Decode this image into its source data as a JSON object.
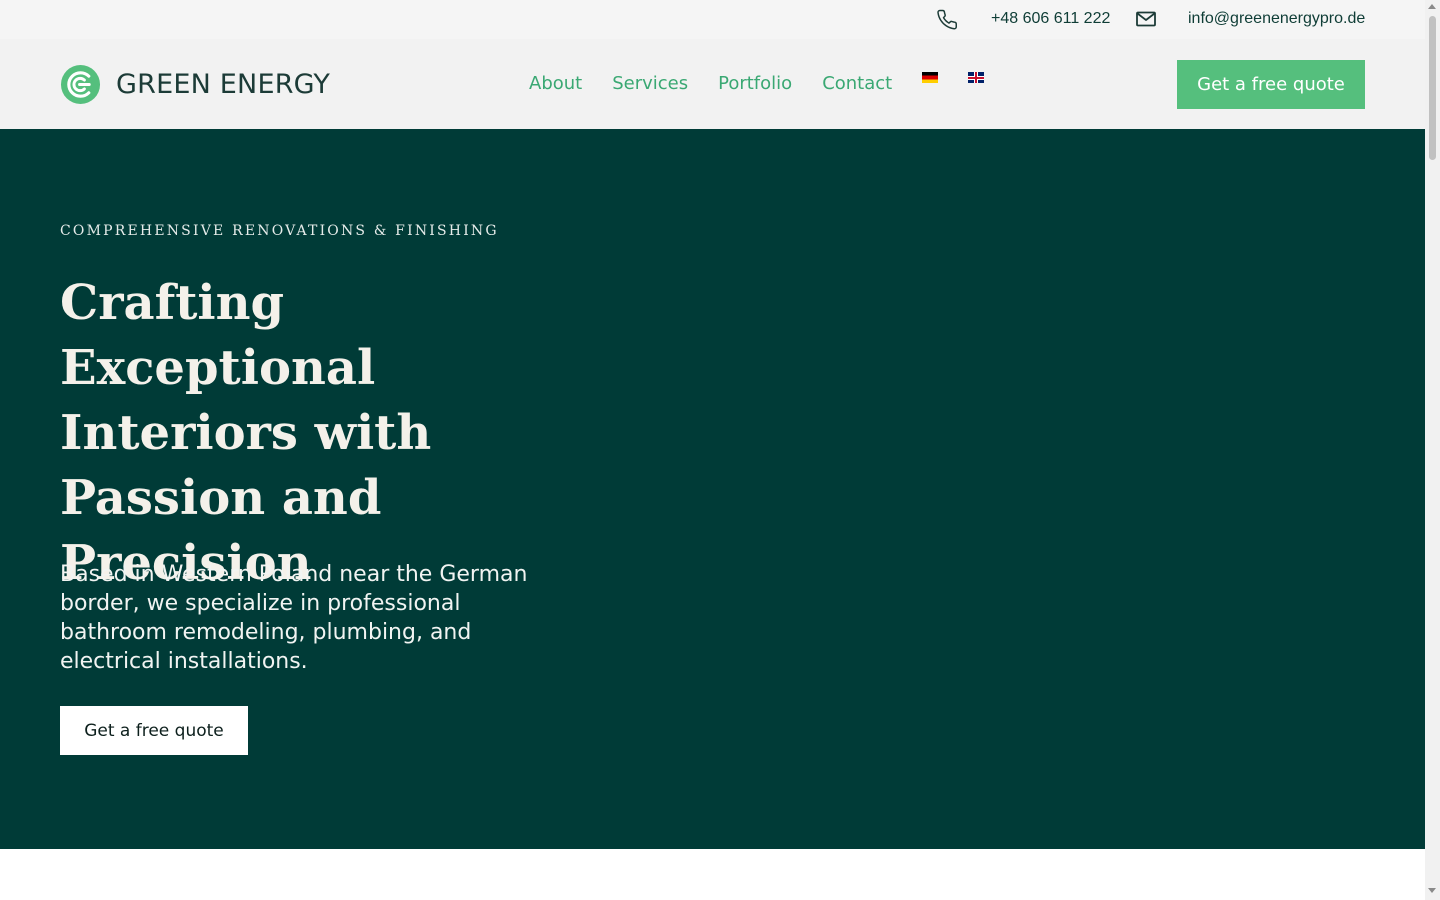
{
  "topbar": {
    "phone": "+48 606 611 222",
    "email": "info@greenenergypro.de",
    "phone_icon": "phone-icon",
    "email_icon": "mail-icon"
  },
  "header": {
    "logo_text": "GREEN ENERGY",
    "nav": {
      "about": "About",
      "services": "Services",
      "portfolio": "Portfolio",
      "contact": "Contact"
    },
    "languages": [
      "de",
      "en"
    ],
    "cta": "Get a free quote"
  },
  "hero": {
    "eyebrow": "COMPREHENSIVE RENOVATIONS & FINISHING",
    "title": "Crafting Exceptional Interiors with Passion and Precision",
    "description": "Based in Western Poland near the German border, we specialize in professional bathroom remodeling, plumbing, and electrical installations.",
    "cta": "Get a free quote"
  },
  "colors": {
    "brand_green": "#55bf7d",
    "nav_green": "#3aa873",
    "hero_bg": "#003b37",
    "topbar_bg": "#f5f5f5"
  }
}
